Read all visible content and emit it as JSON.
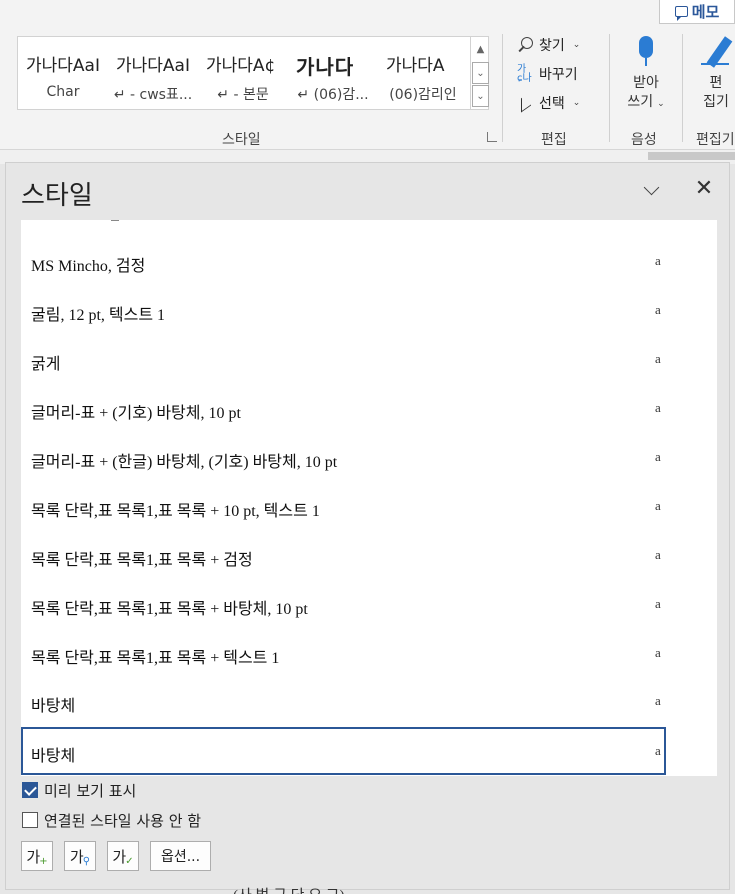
{
  "header": {
    "memo_label": "메모"
  },
  "ribbon": {
    "style_gallery": [
      {
        "sample": "가나다AaI",
        "name": "Char",
        "bold": false
      },
      {
        "sample": "가나다AaI",
        "name": "↵ - cws표...",
        "bold": false
      },
      {
        "sample": "가나다A¢",
        "name": "↵ - 본문",
        "bold": false
      },
      {
        "sample": "가나다",
        "name": "↵ (06)감...",
        "bold": true
      },
      {
        "sample": "가나다A",
        "name": "(06)감리인",
        "bold": false
      }
    ],
    "groups": {
      "styles": "스타일",
      "editing": "편집",
      "voice": "음성",
      "editor": "편집기"
    },
    "editing": {
      "find": "찾기",
      "replace": "바꾸기",
      "select": "선택"
    },
    "dictate": {
      "line1": "받아",
      "line2": "쓰기"
    },
    "editor_btn": {
      "line1": "편",
      "line2": "집기"
    }
  },
  "pane": {
    "title": "스타일",
    "para_mark": "a",
    "items": [
      {
        "label": "MS Mincho, 검정",
        "selected": false
      },
      {
        "label": "굴림, 12 pt, 텍스트 1",
        "selected": false
      },
      {
        "label": "굵게",
        "selected": false
      },
      {
        "label": "글머리-표 + (기호) 바탕체, 10 pt",
        "selected": false
      },
      {
        "label": "글머리-표 + (한글) 바탕체, (기호) 바탕체, 10 pt",
        "selected": false
      },
      {
        "label": "목록 단락,표 목록1,표 목록 + 10 pt, 텍스트 1",
        "selected": false
      },
      {
        "label": "목록 단락,표 목록1,표 목록 + 검정",
        "selected": false
      },
      {
        "label": "목록 단락,표 목록1,표 목록 + 바탕체, 10 pt",
        "selected": false
      },
      {
        "label": "목록 단락,표 목록1,표 목록 + 텍스트 1",
        "selected": false
      },
      {
        "label": "바탕체",
        "selected": false
      },
      {
        "label": "바탕체",
        "selected": true
      }
    ],
    "show_preview": {
      "label": "미리 보기 표시",
      "checked": true
    },
    "disable_linked": {
      "label": "연결된 스타일 사용 안 함",
      "checked": false
    },
    "tools": {
      "new_style_glyph": "가",
      "inspect_glyph": "가",
      "manage_glyph": "가",
      "options_label": "옵션..."
    }
  },
  "document": {
    "peek_text": "(사 법  규 단  요 그)"
  }
}
